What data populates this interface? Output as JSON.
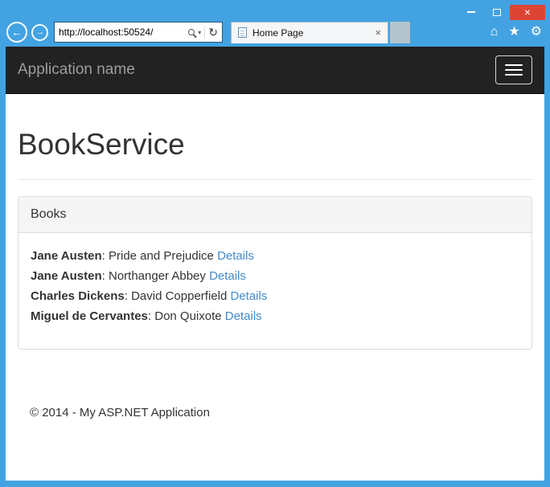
{
  "browser": {
    "window_controls": {
      "close_glyph": "×"
    },
    "nav": {
      "back_glyph": "←",
      "forward_glyph": "→"
    },
    "address": {
      "url": "http://localhost:50524/",
      "dropdown_glyph": "▾",
      "refresh_glyph": "↻"
    },
    "tab": {
      "title": "Home Page",
      "close_glyph": "×"
    },
    "icons": {
      "home": "⌂",
      "favorites": "★",
      "settings": "⚙"
    }
  },
  "navbar": {
    "brand": "Application name"
  },
  "page": {
    "title": "BookService",
    "panel": {
      "header": "Books",
      "separator": ":",
      "books": [
        {
          "author": "Jane Austen",
          "title": "Pride and Prejudice",
          "details_label": "Details"
        },
        {
          "author": "Jane Austen",
          "title": "Northanger Abbey",
          "details_label": "Details"
        },
        {
          "author": "Charles Dickens",
          "title": "David Copperfield",
          "details_label": "Details"
        },
        {
          "author": "Miguel de Cervantes",
          "title": "Don Quixote",
          "details_label": "Details"
        }
      ]
    },
    "footer": "© 2014 - My ASP.NET Application"
  }
}
